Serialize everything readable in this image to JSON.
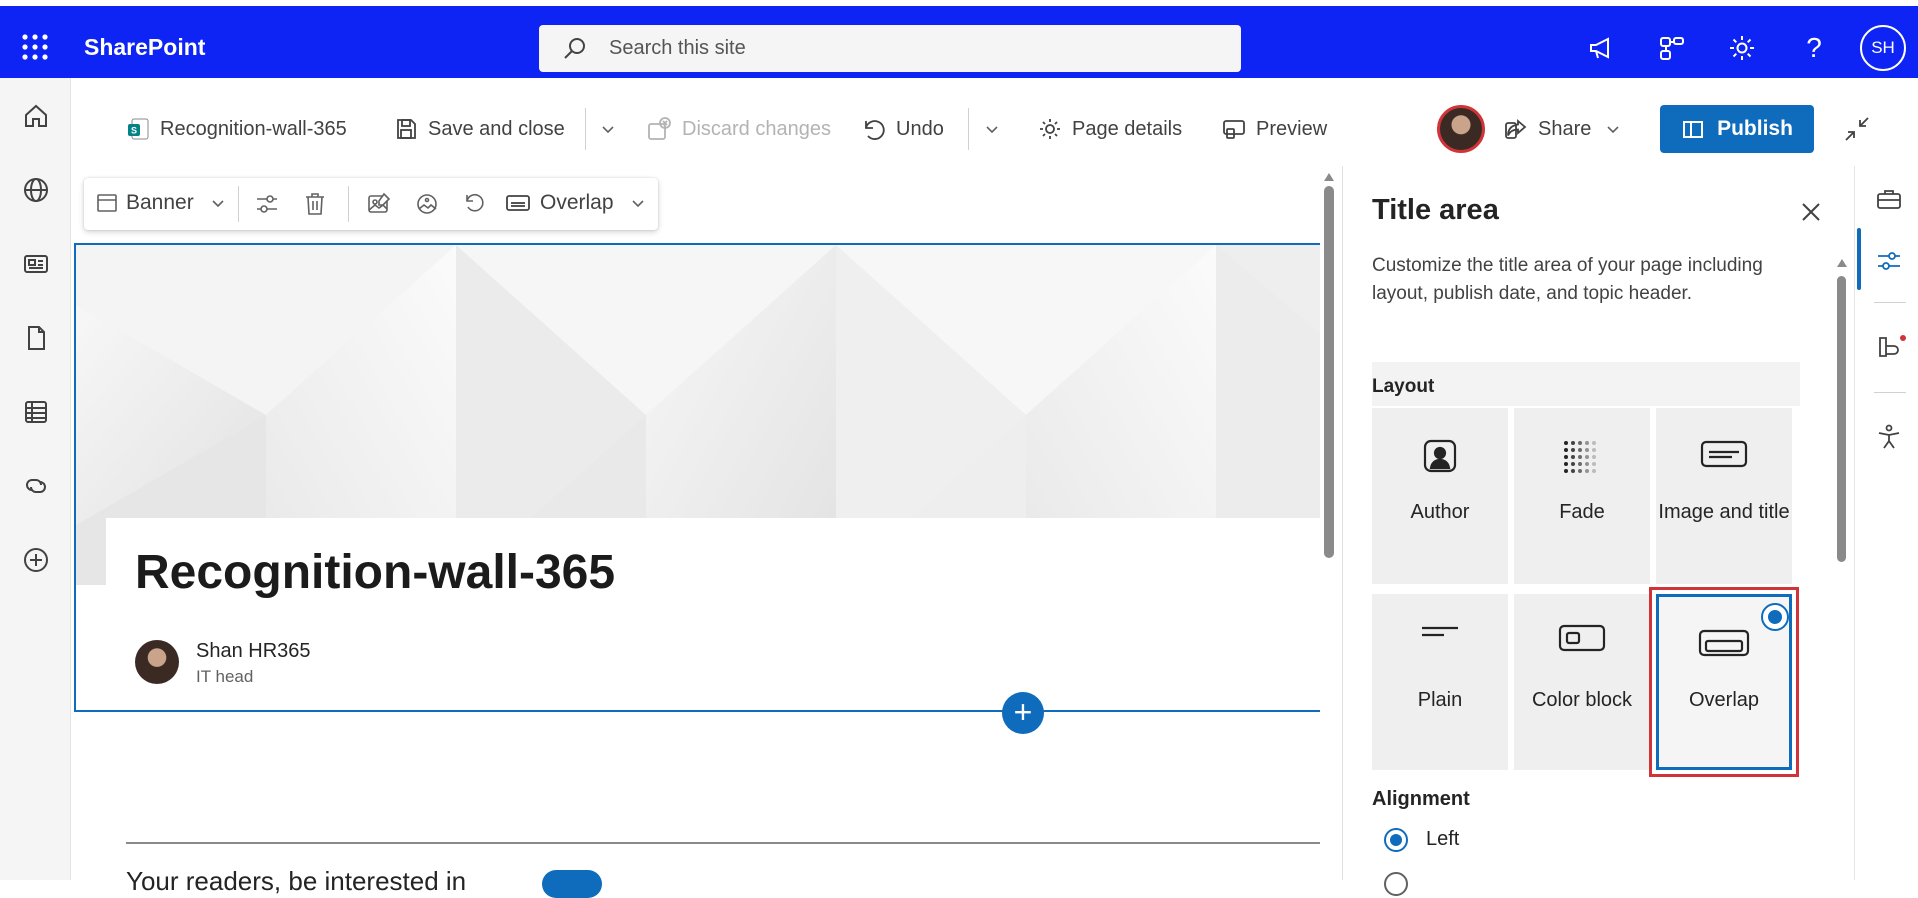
{
  "app": {
    "name": "SharePoint"
  },
  "search": {
    "placeholder": "Search this site"
  },
  "topbar": {
    "user_initials": "SH"
  },
  "command_bar": {
    "page_name": "Recognition-wall-365",
    "save_close": "Save and close",
    "discard": "Discard changes",
    "undo": "Undo",
    "page_details": "Page details",
    "preview": "Preview",
    "share": "Share",
    "publish": "Publish"
  },
  "section_toolbar": {
    "banner": "Banner",
    "layout": "Overlap"
  },
  "page": {
    "title": "Recognition-wall-365",
    "author_name": "Shan HR365",
    "author_role": "IT head",
    "partial_text": "Your readers, be interested in"
  },
  "pane": {
    "title": "Title area",
    "description": "Customize the title area of your page including layout, publish date, and topic header.",
    "layout_heading": "Layout",
    "layouts": [
      {
        "label": "Author"
      },
      {
        "label": "Fade"
      },
      {
        "label": "Image and title"
      },
      {
        "label": "Plain"
      },
      {
        "label": "Color block"
      },
      {
        "label": "Overlap",
        "selected": true
      }
    ],
    "alignment_heading": "Alignment",
    "alignment_options": [
      {
        "label": "Left",
        "selected": true
      }
    ]
  },
  "colors": {
    "topbar": "#0d24f4",
    "accent": "#0f6cbd",
    "highlight": "#d13438"
  }
}
